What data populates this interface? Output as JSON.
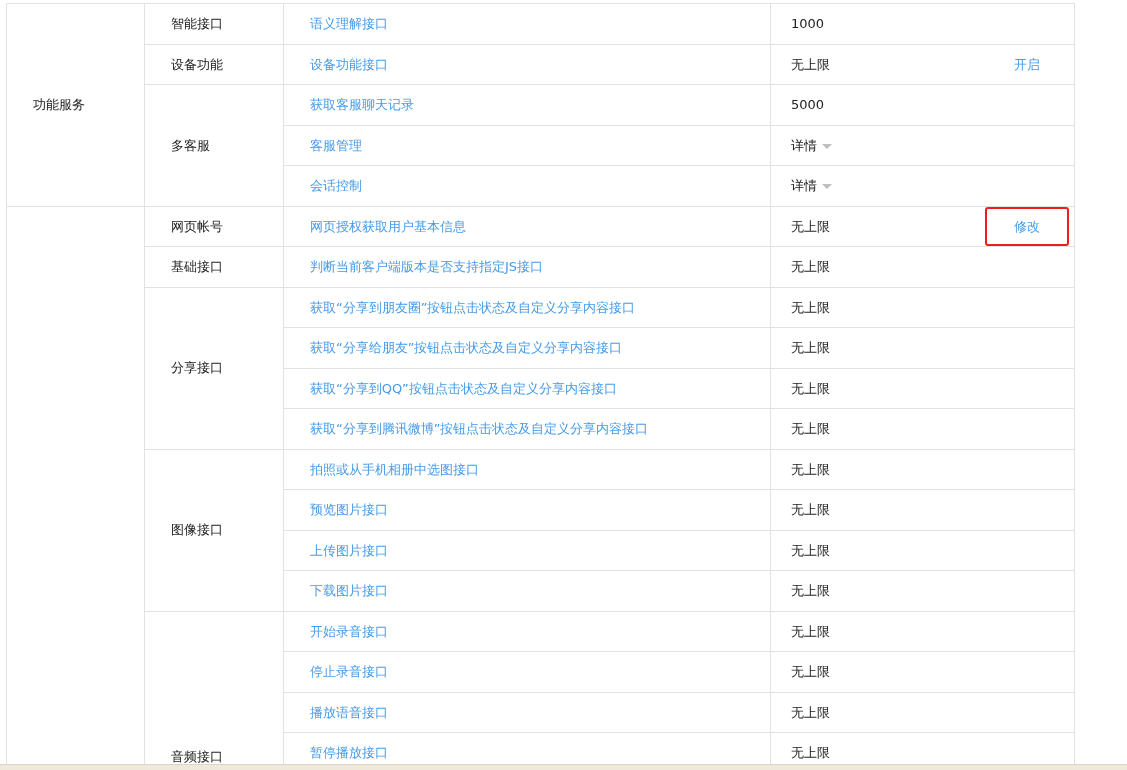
{
  "sections": [
    {
      "category": "功能服务",
      "groups": [
        {
          "name": "智能接口",
          "items": [
            {
              "api": "语义理解接口",
              "quota": "1000",
              "kind": "text"
            }
          ]
        },
        {
          "name": "设备功能",
          "items": [
            {
              "api": "设备功能接口",
              "quota": "无上限",
              "kind": "text",
              "action": {
                "label": "开启",
                "highlighted": false
              }
            }
          ]
        },
        {
          "name": "多客服",
          "items": [
            {
              "api": "获取客服聊天记录",
              "quota": "5000",
              "kind": "text"
            },
            {
              "api": "客服管理",
              "quota": "详情",
              "kind": "dropdown"
            },
            {
              "api": "会话控制",
              "quota": "详情",
              "kind": "dropdown"
            }
          ]
        }
      ]
    },
    {
      "groups": [
        {
          "name": "网页帐号",
          "items": [
            {
              "api": "网页授权获取用户基本信息",
              "quota": "无上限",
              "kind": "text",
              "action": {
                "label": "修改",
                "highlighted": true
              }
            }
          ]
        },
        {
          "name": "基础接口",
          "items": [
            {
              "api": "判断当前客户端版本是否支持指定JS接口",
              "quota": "无上限",
              "kind": "text"
            }
          ]
        },
        {
          "name": "分享接口",
          "items": [
            {
              "api": "获取“分享到朋友圈”按钮点击状态及自定义分享内容接口",
              "quota": "无上限",
              "kind": "text"
            },
            {
              "api": "获取“分享给朋友”按钮点击状态及自定义分享内容接口",
              "quota": "无上限",
              "kind": "text"
            },
            {
              "api": "获取“分享到QQ”按钮点击状态及自定义分享内容接口",
              "quota": "无上限",
              "kind": "text"
            },
            {
              "api": "获取“分享到腾讯微博”按钮点击状态及自定义分享内容接口",
              "quota": "无上限",
              "kind": "text"
            }
          ]
        },
        {
          "name": "图像接口",
          "items": [
            {
              "api": "拍照或从手机相册中选图接口",
              "quota": "无上限",
              "kind": "text"
            },
            {
              "api": "预览图片接口",
              "quota": "无上限",
              "kind": "text"
            },
            {
              "api": "上传图片接口",
              "quota": "无上限",
              "kind": "text"
            },
            {
              "api": "下载图片接口",
              "quota": "无上限",
              "kind": "text"
            }
          ]
        },
        {
          "name": "音频接口",
          "items": [
            {
              "api": "开始录音接口",
              "quota": "无上限",
              "kind": "text"
            },
            {
              "api": "停止录音接口",
              "quota": "无上限",
              "kind": "text"
            },
            {
              "api": "播放语音接口",
              "quota": "无上限",
              "kind": "text"
            },
            {
              "api": "暂停播放接口",
              "quota": "无上限",
              "kind": "text"
            }
          ]
        }
      ]
    }
  ]
}
